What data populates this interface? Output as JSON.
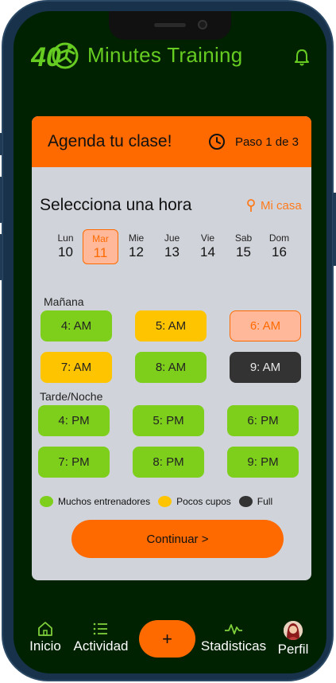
{
  "app": {
    "title": "Minutes Training",
    "logo_text": "40"
  },
  "card": {
    "title": "Agenda tu clase!",
    "step": "Paso 1 de 3",
    "select_title": "Selecciona una hora",
    "location": "Mi casa"
  },
  "days": [
    {
      "name": "Lun",
      "num": "10"
    },
    {
      "name": "Mar",
      "num": "11"
    },
    {
      "name": "Mie",
      "num": "12"
    },
    {
      "name": "Jue",
      "num": "13"
    },
    {
      "name": "Vie",
      "num": "14"
    },
    {
      "name": "Sab",
      "num": "15"
    },
    {
      "name": "Dom",
      "num": "16"
    }
  ],
  "selected_day": "Mar",
  "morning": {
    "label": "Mañana",
    "slots": [
      {
        "time": "4: AM",
        "status": "muchos"
      },
      {
        "time": "5: AM",
        "status": "pocos"
      },
      {
        "time": "6: AM",
        "status": "selected"
      },
      {
        "time": "7: AM",
        "status": "pocos"
      },
      {
        "time": "8: AM",
        "status": "muchos"
      },
      {
        "time": "9: AM",
        "status": "full"
      }
    ]
  },
  "evening": {
    "label": "Tarde/Noche",
    "slots": [
      {
        "time": "4: PM",
        "status": "muchos"
      },
      {
        "time": "5: PM",
        "status": "muchos"
      },
      {
        "time": "6: PM",
        "status": "muchos"
      },
      {
        "time": "7: PM",
        "status": "muchos"
      },
      {
        "time": "8: PM",
        "status": "muchos"
      },
      {
        "time": "9: PM",
        "status": "muchos"
      }
    ]
  },
  "legend": [
    {
      "label": "Muchos entrenadores",
      "color": "#7ecf1c"
    },
    {
      "label": "Pocos cupos",
      "color": "#ffc400"
    },
    {
      "label": "Full",
      "color": "#333333"
    }
  ],
  "continue_label": "Continuar >",
  "nav": {
    "inicio": "Inicio",
    "actividad": "Actividad",
    "add": "+",
    "estadisticas": "Stadisticas",
    "perfil": "Perfil"
  },
  "colors": {
    "accent": "#ff6a00",
    "brand_green": "#66cc22",
    "background": "#002201"
  }
}
